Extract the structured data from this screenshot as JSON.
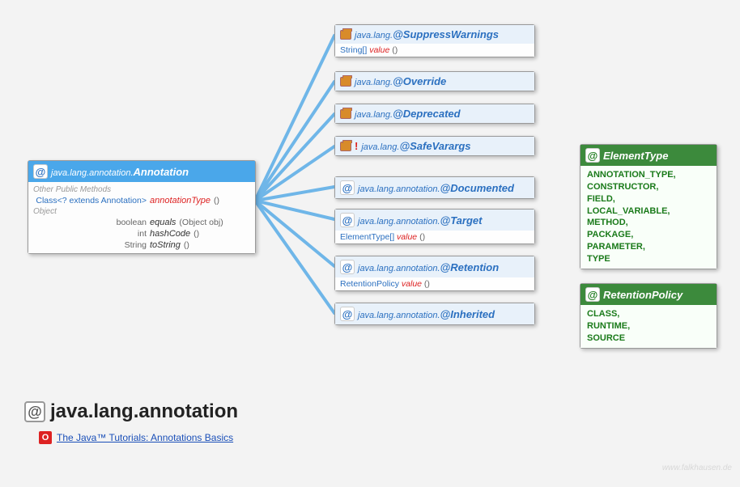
{
  "root": {
    "icon": "at-icon",
    "package": "java.lang.annotation.",
    "name": "Annotation",
    "section1": "Other Public Methods",
    "method1": {
      "ret": "Class<? extends Annotation>",
      "name": "annotationType",
      "params": "()"
    },
    "section2": "Object",
    "method2": {
      "ret": "boolean",
      "name": "equals",
      "params": "(Object obj)"
    },
    "method3": {
      "ret": "int",
      "name": "hashCode",
      "params": "()"
    },
    "method4": {
      "ret": "String",
      "name": "toString",
      "params": "()"
    }
  },
  "children": [
    {
      "icon": "pkg",
      "excl": false,
      "pkg": "java.lang.",
      "name": "@SuppressWarnings",
      "body": {
        "type": "String[]",
        "method": "value",
        "params": "()"
      }
    },
    {
      "icon": "pkg",
      "excl": false,
      "pkg": "java.lang.",
      "name": "@Override",
      "body": null
    },
    {
      "icon": "pkg",
      "excl": false,
      "pkg": "java.lang.",
      "name": "@Deprecated",
      "body": null
    },
    {
      "icon": "pkg",
      "excl": true,
      "pkg": "java.lang.",
      "name": "@SafeVarargs",
      "body": null
    },
    {
      "icon": "at",
      "excl": false,
      "pkg": "java.lang.annotation.",
      "name": "@Documented",
      "body": null
    },
    {
      "icon": "at",
      "excl": false,
      "pkg": "java.lang.annotation.",
      "name": "@Target",
      "body": {
        "type": "ElementType[]",
        "method": "value",
        "params": "()"
      }
    },
    {
      "icon": "at",
      "excl": false,
      "pkg": "java.lang.annotation.",
      "name": "@Retention",
      "body": {
        "type": "RetentionPolicy",
        "method": "value",
        "params": "()"
      }
    },
    {
      "icon": "at",
      "excl": false,
      "pkg": "java.lang.annotation.",
      "name": "@Inherited",
      "body": null
    }
  ],
  "enums": {
    "elementType": {
      "name": "ElementType",
      "values": [
        "ANNOTATION_TYPE,",
        "CONSTRUCTOR,",
        "FIELD,",
        "LOCAL_VARIABLE,",
        "METHOD,",
        "PACKAGE,",
        "PARAMETER,",
        "TYPE"
      ]
    },
    "retentionPolicy": {
      "name": "RetentionPolicy",
      "values": [
        "CLASS,",
        "RUNTIME,",
        "SOURCE"
      ]
    }
  },
  "title": {
    "text": "java.lang.annotation",
    "link": "The Java™ Tutorials: Annotations Basics"
  },
  "watermark": "www.falkhausen.de",
  "layout": {
    "childTops": [
      30,
      88,
      128,
      168,
      218,
      258,
      316,
      374
    ]
  }
}
